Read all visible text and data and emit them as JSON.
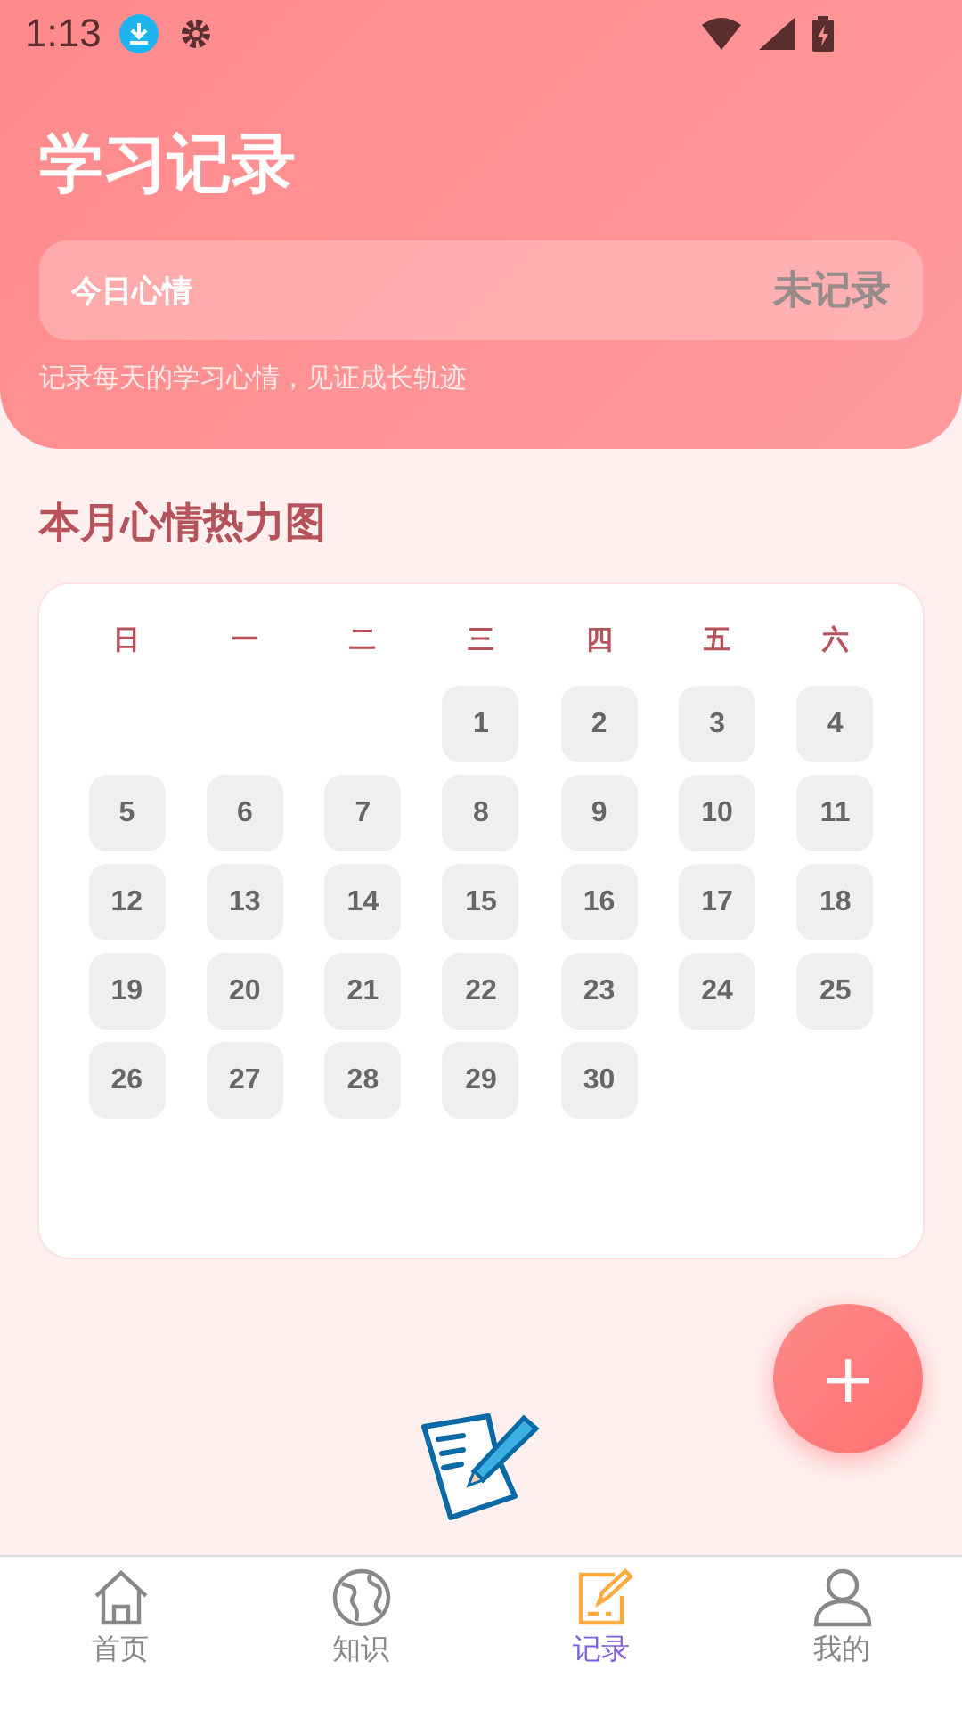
{
  "status_bar": {
    "time": "1:13"
  },
  "header": {
    "title": "学习记录",
    "mood": {
      "label": "今日心情",
      "value": "未记录"
    },
    "subtitle": "记录每天的学习心情，见证成长轨迹"
  },
  "heatmap": {
    "title": "本月心情热力图",
    "weekdays": [
      "日",
      "一",
      "二",
      "三",
      "四",
      "五",
      "六"
    ],
    "weeks": [
      {
        "kind": "first",
        "days": [
          "1",
          "2",
          "3",
          "4"
        ]
      },
      {
        "kind": "week",
        "days": [
          "5",
          "6",
          "7",
          "8",
          "9",
          "10",
          "11"
        ]
      },
      {
        "kind": "week",
        "days": [
          "12",
          "13",
          "14",
          "15",
          "16",
          "17",
          "18"
        ]
      },
      {
        "kind": "week",
        "days": [
          "19",
          "20",
          "21",
          "22",
          "23",
          "24",
          "25"
        ]
      },
      {
        "kind": "week",
        "days": [
          "26",
          "27",
          "28",
          "29",
          "30"
        ]
      }
    ]
  },
  "fab": {
    "label": "+"
  },
  "bottom_nav": [
    {
      "kind": "home",
      "label": "首页",
      "selected": false
    },
    {
      "kind": "globe",
      "label": "知识",
      "selected": false
    },
    {
      "kind": "edit",
      "label": "记录",
      "selected": true
    },
    {
      "kind": "user",
      "label": "我的",
      "selected": false
    }
  ]
}
